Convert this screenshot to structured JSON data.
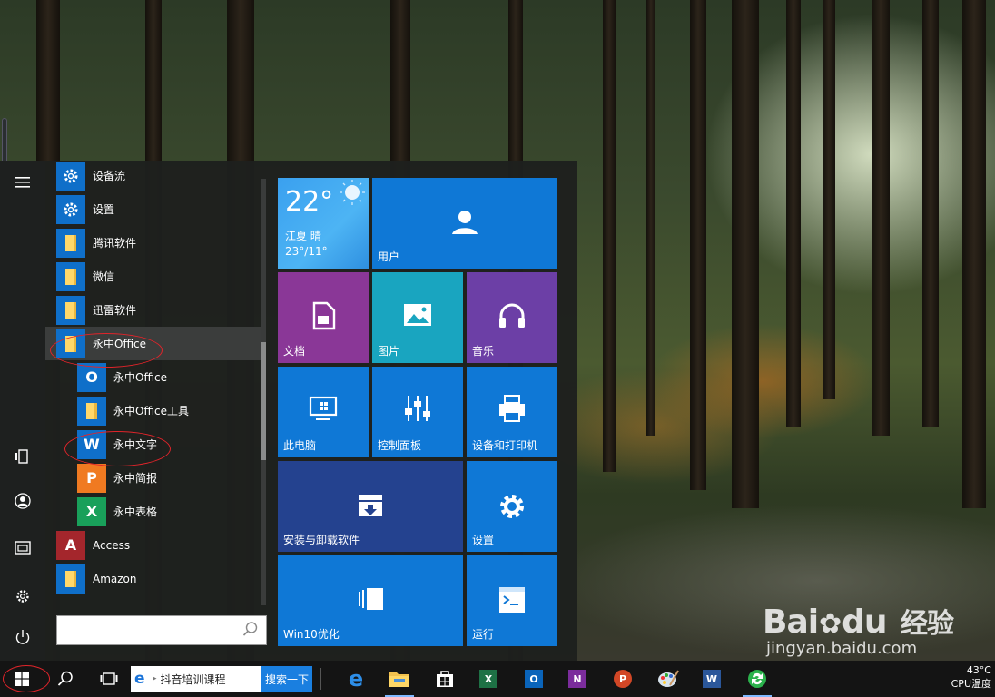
{
  "app_list": [
    {
      "label": "设备流",
      "icon": "gear-icon",
      "color": "#0f6fc9",
      "indent": false
    },
    {
      "label": "设置",
      "icon": "gear-icon",
      "color": "#0f6fc9",
      "indent": false
    },
    {
      "label": "腾讯软件",
      "icon": "folder-icon",
      "color": "#0f6fc9",
      "indent": false
    },
    {
      "label": "微信",
      "icon": "folder-icon",
      "color": "#0f6fc9",
      "indent": false
    },
    {
      "label": "迅雷软件",
      "icon": "folder-icon",
      "color": "#0f6fc9",
      "indent": false
    },
    {
      "label": "永中Office",
      "icon": "folder-icon",
      "color": "#0f6fc9",
      "indent": false,
      "selected": true
    },
    {
      "label": "永中Office",
      "icon": "yozo-office-icon",
      "glyph": "O",
      "color": "#0f6fc9",
      "indent": true
    },
    {
      "label": "永中Office工具",
      "icon": "folder-icon",
      "color": "#0f6fc9",
      "indent": true
    },
    {
      "label": "永中文字",
      "icon": "yozo-writer-icon",
      "glyph": "W",
      "color": "#0f6fc9",
      "indent": true
    },
    {
      "label": "永中简报",
      "icon": "yozo-presentation-icon",
      "glyph": "P",
      "color": "#f07a21",
      "indent": true
    },
    {
      "label": "永中表格",
      "icon": "yozo-spreadsheet-icon",
      "glyph": "X",
      "color": "#19a05a",
      "indent": true
    },
    {
      "label": "Access",
      "icon": "access-icon",
      "glyph": "A",
      "color": "#a4262c",
      "indent": false
    },
    {
      "label": "Amazon",
      "icon": "folder-icon",
      "color": "#0f6fc9",
      "indent": false
    }
  ],
  "search": {
    "placeholder": ""
  },
  "weather": {
    "temp": "22°",
    "location": "江夏 晴",
    "range": "23°/11°"
  },
  "tiles": {
    "user": "用户",
    "documents": "文档",
    "pictures": "图片",
    "music": "音乐",
    "this_pc": "此电脑",
    "control_panel": "控制面板",
    "devices_printers": "设备和打印机",
    "install_uninstall": "安装与卸载软件",
    "settings": "设置",
    "win10_optimize": "Win10优化",
    "run": "运行"
  },
  "taskbar": {
    "address_text": "抖音培训课程",
    "search_button": "搜索一下",
    "apps": [
      "edge-icon",
      "file-explorer-icon",
      "store-icon",
      "excel-icon",
      "outlook-icon",
      "onenote-icon",
      "powerpoint-icon",
      "paint-icon",
      "word-icon",
      "green-app-icon"
    ]
  },
  "tray": {
    "temperature": "43°C",
    "cpu_label": "CPU温度"
  },
  "watermark": {
    "brand": "Bai",
    "brand2": "du",
    "cn": "经验",
    "url": "jingyan.baidu.com"
  },
  "colors": {
    "accent": "#0f78d6",
    "annotation": "#e0242a"
  }
}
